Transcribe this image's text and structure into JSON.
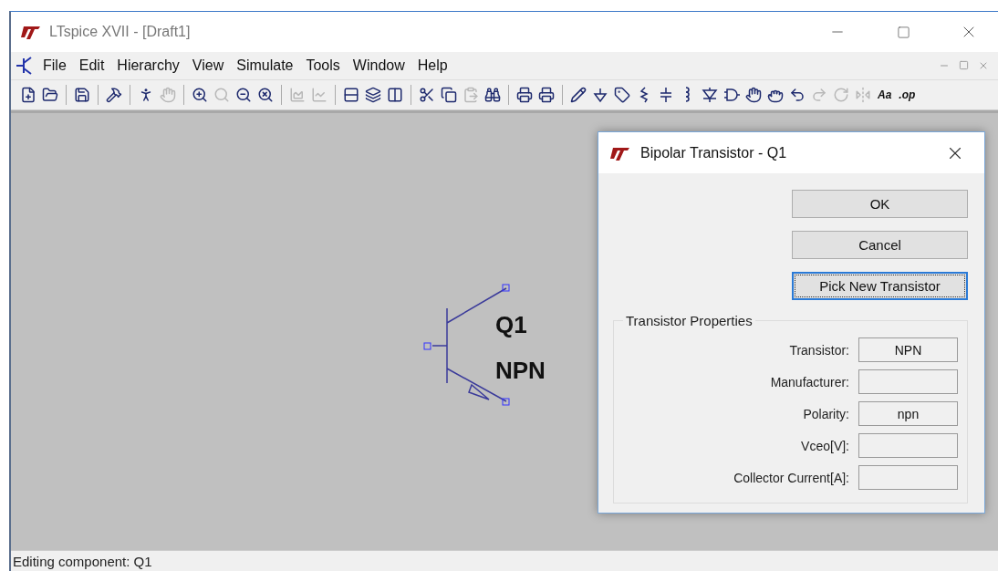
{
  "window": {
    "title": "LTspice XVII - [Draft1]"
  },
  "menu": [
    "File",
    "Edit",
    "Hierarchy",
    "View",
    "Simulate",
    "Tools",
    "Window",
    "Help"
  ],
  "toolbar": [
    {
      "kind": "new",
      "disabled": false
    },
    {
      "kind": "open",
      "disabled": false
    },
    {
      "kind": "separator"
    },
    {
      "kind": "save",
      "disabled": false
    },
    {
      "kind": "separator"
    },
    {
      "kind": "control-panel",
      "disabled": false
    },
    {
      "kind": "separator"
    },
    {
      "kind": "run",
      "disabled": false
    },
    {
      "kind": "halt",
      "disabled": true
    },
    {
      "kind": "separator"
    },
    {
      "kind": "zoom-in",
      "disabled": false
    },
    {
      "kind": "pan",
      "disabled": true
    },
    {
      "kind": "zoom-out",
      "disabled": false
    },
    {
      "kind": "zoom-cancel",
      "disabled": false
    },
    {
      "kind": "separator"
    },
    {
      "kind": "autorange",
      "disabled": true
    },
    {
      "kind": "mark",
      "disabled": true
    },
    {
      "kind": "separator"
    },
    {
      "kind": "tile-horizontal",
      "disabled": false
    },
    {
      "kind": "cascade",
      "disabled": false
    },
    {
      "kind": "tile-vertical",
      "disabled": false
    },
    {
      "kind": "separator"
    },
    {
      "kind": "cut",
      "disabled": false
    },
    {
      "kind": "copy",
      "disabled": false
    },
    {
      "kind": "paste",
      "disabled": true
    },
    {
      "kind": "find",
      "disabled": false
    },
    {
      "kind": "separator"
    },
    {
      "kind": "print-setup",
      "disabled": false
    },
    {
      "kind": "print",
      "disabled": false
    },
    {
      "kind": "separator"
    },
    {
      "kind": "wire",
      "disabled": false
    },
    {
      "kind": "ground",
      "disabled": false
    },
    {
      "kind": "label",
      "disabled": false
    },
    {
      "kind": "resistor",
      "disabled": false
    },
    {
      "kind": "capacitor",
      "disabled": false
    },
    {
      "kind": "inductor",
      "disabled": false
    },
    {
      "kind": "diode",
      "disabled": false
    },
    {
      "kind": "component",
      "disabled": false
    },
    {
      "kind": "move",
      "disabled": false
    },
    {
      "kind": "drag",
      "disabled": false
    },
    {
      "kind": "undo",
      "disabled": false
    },
    {
      "kind": "redo",
      "disabled": true
    },
    {
      "kind": "rotate",
      "disabled": true
    },
    {
      "kind": "mirror",
      "disabled": true
    },
    {
      "kind": "text",
      "label": "Aa",
      "disabled": false
    },
    {
      "kind": "text",
      "label": ".op",
      "disabled": false
    }
  ],
  "canvas": {
    "component": {
      "name": "Q1",
      "value": "NPN"
    }
  },
  "dialog": {
    "title": "Bipolar Transistor - Q1",
    "buttons": [
      {
        "label": "OK",
        "focused": false
      },
      {
        "label": "Cancel",
        "focused": false
      },
      {
        "label": "Pick New Transistor",
        "focused": true
      }
    ],
    "group": {
      "title": "Transistor Properties",
      "fields": [
        {
          "label": "Transistor:",
          "value": "NPN"
        },
        {
          "label": "Manufacturer:"
        },
        {
          "label": "Polarity:",
          "value": "npn"
        },
        {
          "label": "Vceo[V]:"
        },
        {
          "label": "Collector Current[A]:"
        }
      ]
    }
  },
  "status_bar": {
    "text": "Editing component: Q1"
  }
}
